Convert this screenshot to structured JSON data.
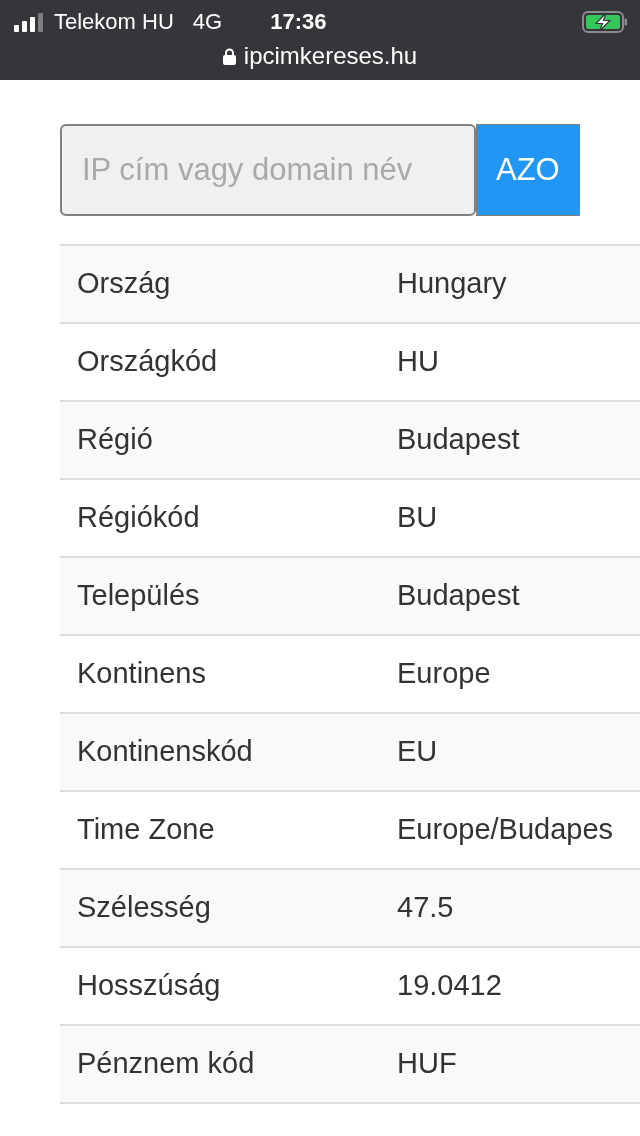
{
  "status_bar": {
    "carrier": "Telekom HU",
    "network": "4G",
    "time": "17:36",
    "url": "ipcimkereses.hu"
  },
  "search": {
    "placeholder": "IP cím vagy domain név",
    "button": "AZO"
  },
  "table": {
    "rows": [
      {
        "label": "Ország",
        "value": "Hungary"
      },
      {
        "label": "Országkód",
        "value": "HU"
      },
      {
        "label": "Régió",
        "value": "Budapest"
      },
      {
        "label": "Régiókód",
        "value": "BU"
      },
      {
        "label": "Település",
        "value": "Budapest"
      },
      {
        "label": "Kontinens",
        "value": "Europe"
      },
      {
        "label": "Kontinenskód",
        "value": "EU"
      },
      {
        "label": "Time Zone",
        "value": "Europe/Budapes"
      },
      {
        "label": "Szélesség",
        "value": "47.5"
      },
      {
        "label": "Hosszúság",
        "value": "19.0412"
      },
      {
        "label": "Pénznem kód",
        "value": "HUF"
      }
    ]
  }
}
